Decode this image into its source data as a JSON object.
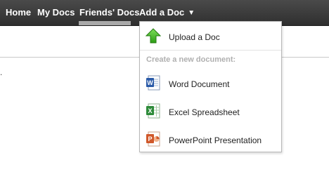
{
  "nav": {
    "items": [
      {
        "label": "Home"
      },
      {
        "label": "My Docs"
      },
      {
        "label": "Friends' Docs"
      },
      {
        "label": "Add a Doc"
      }
    ],
    "dropdown_arrow": "▼"
  },
  "page": {
    "stray_text": "."
  },
  "menu": {
    "upload_label": "Upload a Doc",
    "upload_icon": "green-up-arrow-icon",
    "section_heading": "Create a new document:",
    "items": [
      {
        "label": "Word Document",
        "icon": "word-document-icon",
        "letter": "W"
      },
      {
        "label": "Excel Spreadsheet",
        "icon": "excel-spreadsheet-icon",
        "letter": "X"
      },
      {
        "label": "PowerPoint Presentation",
        "icon": "powerpoint-presentation-icon",
        "letter": "P"
      }
    ]
  },
  "colors": {
    "nav_background": "#3a3a3a",
    "nav_active_underline": "#a9a9a9",
    "upload_arrow": "#3cb31c",
    "word_blue": "#2a5aa8",
    "excel_green": "#2e8b3a",
    "powerpoint_orange": "#d0582a"
  }
}
